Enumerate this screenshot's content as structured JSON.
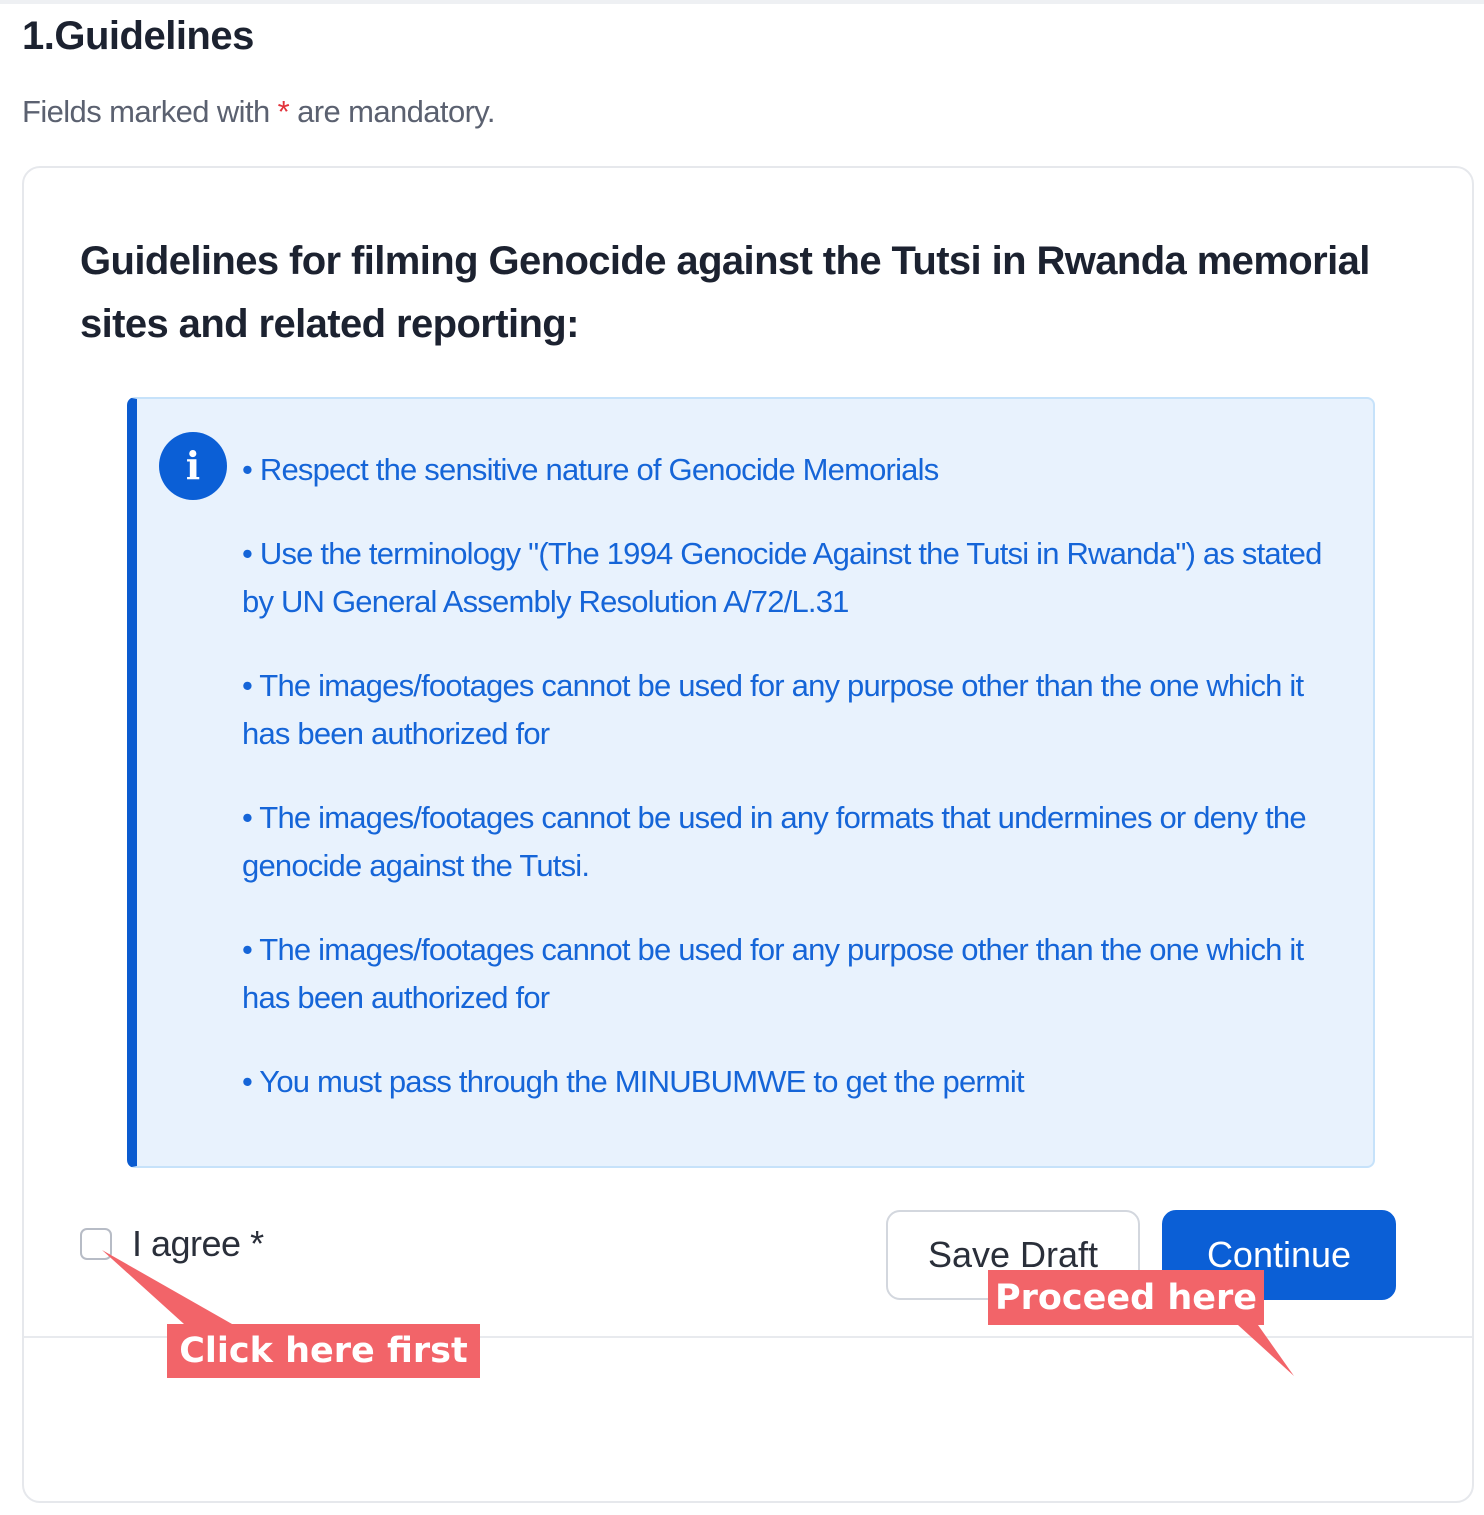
{
  "section": {
    "title": "1.Guidelines",
    "mandatory_prefix": "Fields marked with ",
    "mandatory_asterisk": "*",
    "mandatory_suffix": " are mandatory."
  },
  "card": {
    "heading": "Guidelines for filming Genocide against the Tutsi in Rwanda memorial sites and related reporting:",
    "info_icon": "info-icon",
    "guidelines": [
      "• Respect the sensitive nature of Genocide Memorials",
      "• Use the terminology \"(The 1994 Genocide Against the Tutsi in Rwanda\") as stated by UN General Assembly Resolution A/72/L.31",
      "• The images/footages cannot be used for any purpose other than the one which it has been authorized for",
      "• The images/footages cannot be used in any formats that undermines or deny the genocide against the Tutsi.",
      "• The images/footages cannot be used for any purpose other than the one which it has been authorized for",
      "• You must pass through the MINUBUMWE to get the permit"
    ],
    "agree_label": "I agree *"
  },
  "actions": {
    "save_draft": "Save Draft",
    "continue": "Continue"
  },
  "annotations": {
    "click_first": "Click here first",
    "proceed": "Proceed here"
  },
  "colors": {
    "primary": "#0b5fd6",
    "info_background": "#e8f2fd",
    "info_text": "#1565d8",
    "required_asterisk": "#e2333b",
    "annotation": "#f26469"
  }
}
